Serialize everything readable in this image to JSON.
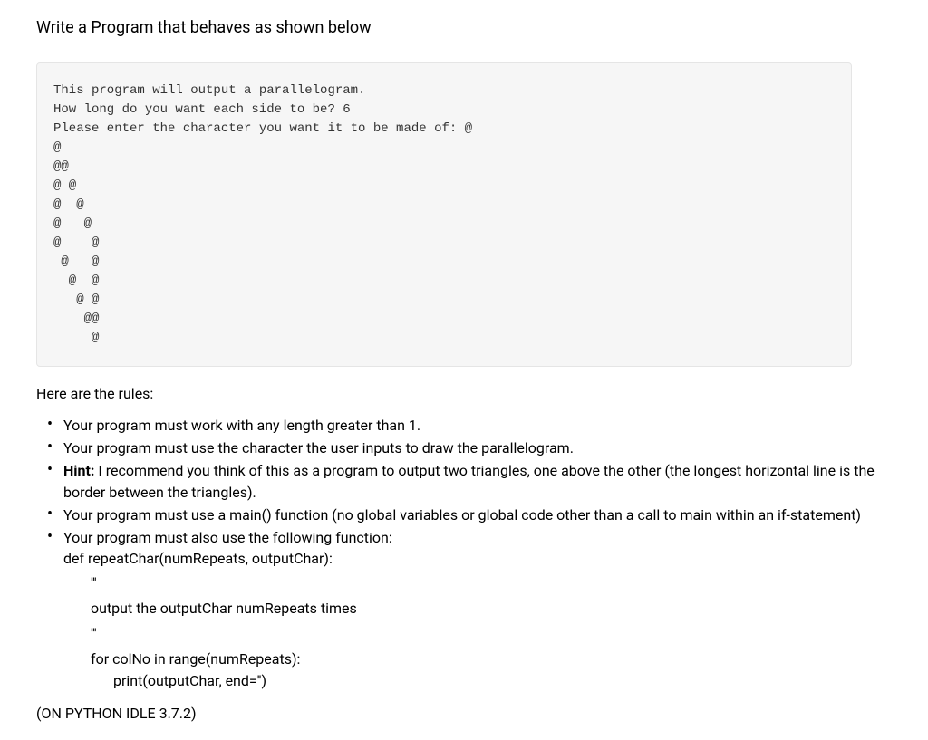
{
  "title": "Write a Program that behaves as shown below",
  "code_block": "This program will output a parallelogram.\nHow long do you want each side to be? 6\nPlease enter the character you want it to be made of: @\n@\n@@\n@ @\n@  @\n@   @\n@    @\n @   @\n  @  @\n   @ @\n    @@\n     @",
  "rules_heading": "Here are the rules:",
  "rules": {
    "r1": "Your program must work with any length greater than 1.",
    "r2": "Your program must use the character the user inputs to draw the parallelogram.",
    "r3_prefix": "Hint:",
    "r3_rest": " I recommend you think of this as a program to output two triangles, one above the other (the longest horizontal line is the border between the triangles).",
    "r4": "Your program must use a main() function (no global variables or global code other than a call to main within an if-statement)",
    "r5": "Your program must also use the following function:",
    "func_def": "def repeatChar(numRepeats, outputChar):",
    "docq1": "'''",
    "docline": "output the outputChar numRepeats times",
    "docq2": "'''",
    "forline": "for colNo in range(numRepeats):",
    "printline": "print(outputChar, end='')"
  },
  "footer": "(ON PYTHON IDLE 3.7.2)"
}
